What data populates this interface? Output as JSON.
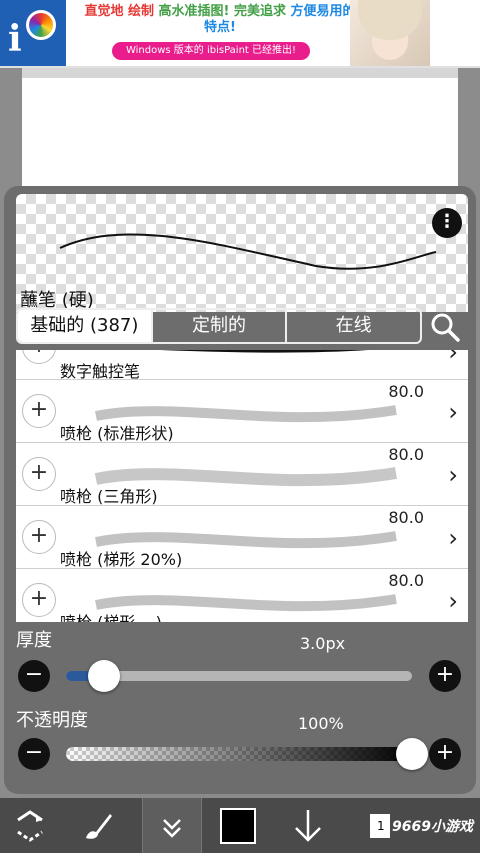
{
  "ad": {
    "line1_a": "直觉地",
    "line1_b": "绘制",
    "line1_c": "高水准插图!",
    "line1_d": "完美追求",
    "line1_e": "方便易用的",
    "line2": "特点!",
    "pill": "Windows 版本的 ibisPaint 已经推出!"
  },
  "brush": {
    "name": "蘸笔 (硬)",
    "more_icon": "more-vertical-icon"
  },
  "tabs": [
    {
      "label": "基础的 (387)"
    },
    {
      "label": "定制的"
    },
    {
      "label": "在线"
    }
  ],
  "brush_list": [
    {
      "name": "数字触控笔",
      "value": ""
    },
    {
      "name": "喷枪 (标准形状)",
      "value": "80.0"
    },
    {
      "name": "喷枪 (三角形)",
      "value": "80.0"
    },
    {
      "name": "喷枪 (梯形 20%)",
      "value": "80.0"
    },
    {
      "name": "喷枪 (梯形 ...)",
      "value": "80.0"
    }
  ],
  "thickness": {
    "label": "厚度",
    "value_text": "3.0px",
    "level": 0.11
  },
  "opacity": {
    "label": "不透明度",
    "value_text": "100%",
    "level": 1.0
  },
  "toolbar": {
    "watermark": "9669小游戏",
    "color": "#000000",
    "icons": [
      "transform-icon",
      "brush-icon",
      "collapse-icon",
      "color-swatch",
      "download-arrow-icon",
      "layers-icon"
    ]
  },
  "colors": {
    "accent": "#2a5a9a",
    "panel": "#6d6d6d",
    "ad_pill": "#e91e8c"
  }
}
